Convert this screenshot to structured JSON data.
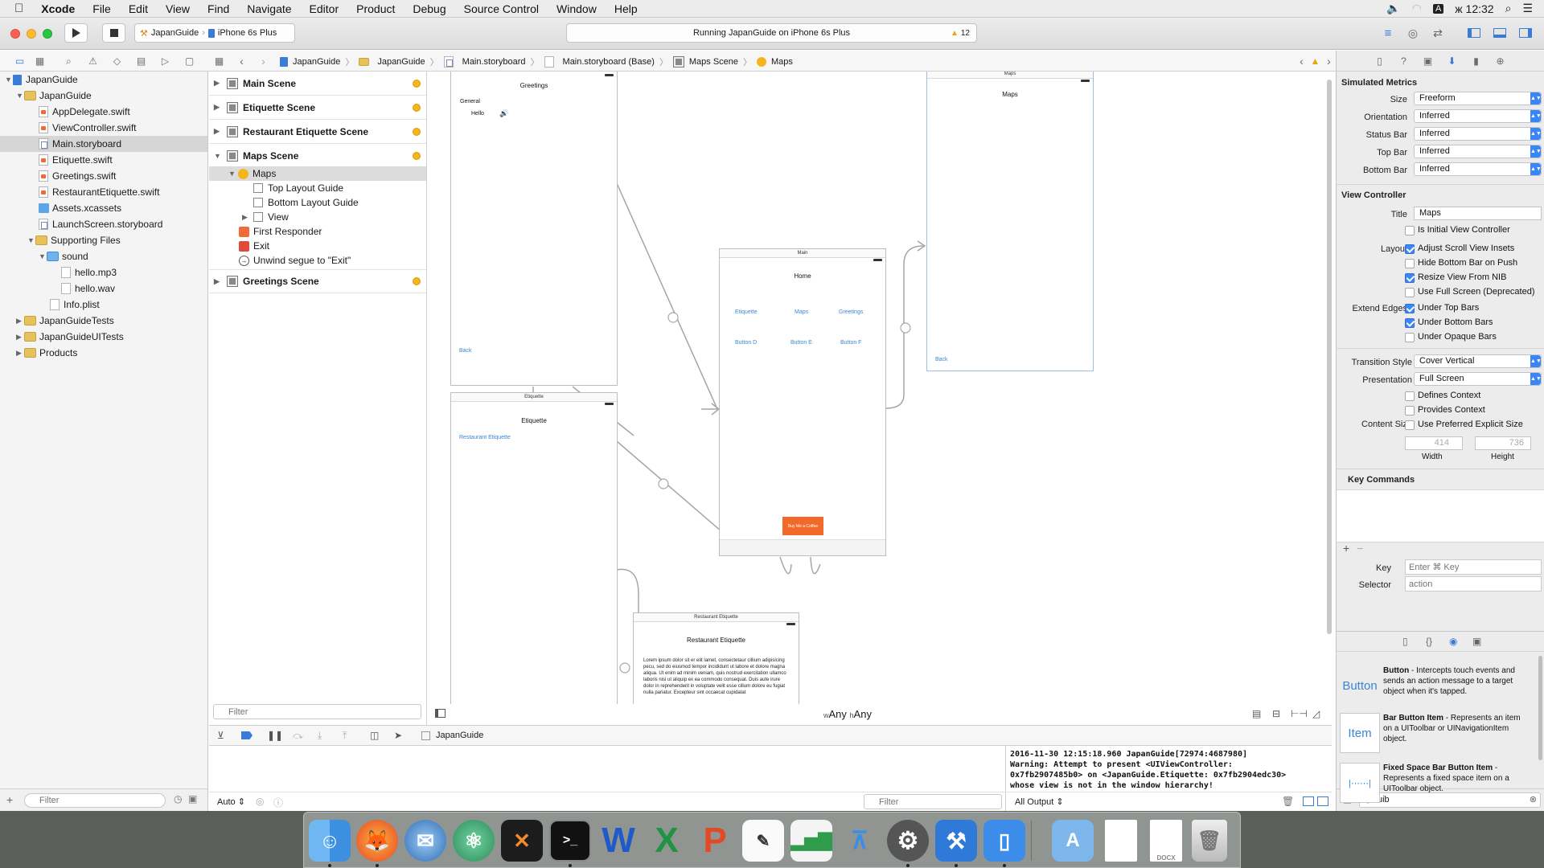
{
  "menubar": {
    "items": [
      "Xcode",
      "File",
      "Edit",
      "View",
      "Find",
      "Navigate",
      "Editor",
      "Product",
      "Debug",
      "Source Control",
      "Window",
      "Help"
    ],
    "input_source": "A",
    "clock": "ж 12:32"
  },
  "toolbar": {
    "scheme": "JapanGuide",
    "device": "iPhone 6s Plus",
    "status": "Running JapanGuide on iPhone 6s Plus",
    "warning_count": "12"
  },
  "jumpbar": {
    "crumbs": [
      "JapanGuide",
      "JapanGuide",
      "Main.storyboard",
      "Main.storyboard (Base)",
      "Maps Scene",
      "Maps"
    ]
  },
  "navigator": {
    "items": [
      {
        "label": "JapanGuide",
        "type": "project"
      },
      {
        "label": "JapanGuide",
        "type": "folder"
      },
      {
        "label": "AppDelegate.swift",
        "type": "swift"
      },
      {
        "label": "ViewController.swift",
        "type": "swift"
      },
      {
        "label": "Main.storyboard",
        "type": "storyboard"
      },
      {
        "label": "Etiquette.swift",
        "type": "swift"
      },
      {
        "label": "Greetings.swift",
        "type": "swift"
      },
      {
        "label": "RestaurantEtiquette.swift",
        "type": "swift"
      },
      {
        "label": "Assets.xcassets",
        "type": "assets"
      },
      {
        "label": "LaunchScreen.storyboard",
        "type": "storyboard"
      },
      {
        "label": "Supporting Files",
        "type": "folder"
      },
      {
        "label": "sound",
        "type": "folder-blue"
      },
      {
        "label": "hello.mp3",
        "type": "file"
      },
      {
        "label": "hello.wav",
        "type": "file"
      },
      {
        "label": "Info.plist",
        "type": "file"
      },
      {
        "label": "JapanGuideTests",
        "type": "folder"
      },
      {
        "label": "JapanGuideUITests",
        "type": "folder"
      },
      {
        "label": "Products",
        "type": "folder"
      }
    ],
    "filter_placeholder": "Filter"
  },
  "outline": {
    "scenes": [
      "Main Scene",
      "Etiquette Scene",
      "Restaurant Etiquette Scene",
      "Maps Scene",
      "Greetings Scene"
    ],
    "maps_children": [
      "Maps",
      "Top Layout Guide",
      "Bottom Layout Guide",
      "View",
      "First Responder",
      "Exit",
      "Unwind segue to \"Exit\""
    ],
    "filter_placeholder": "Filter"
  },
  "canvas": {
    "greetings": {
      "title": "Greetings",
      "label": "General",
      "hello": "Hello",
      "back": "Back"
    },
    "etiquette": {
      "header": "Etiquette",
      "title": "Etiquette",
      "link": "Restaurant Etiquette"
    },
    "main": {
      "header": "Main",
      "title": "Home",
      "row1": [
        "Etiquette",
        "Maps",
        "Greetings"
      ],
      "row2": [
        "Button D",
        "Button E",
        "Button F"
      ],
      "coffee": "Buy Me a Coffee"
    },
    "maps": {
      "header": "Maps",
      "title": "Maps",
      "back": "Back"
    },
    "restaurant": {
      "header": "Restaurant Etiquette",
      "title": "Restaurant Etiquette",
      "body": "Lorem ipsum dolor sit er elit lamet, consectetaur cillium adipisicing pecu, sed do eiusmod tempor incididunt ut labore et dolore magna aliqua. Ut enim ad minim veniam, quis nostrud exercitation ullamco laboris nisi ut aliquip ex ea commodo consequat. Duis aute irure dolor in reprehenderit in voluptate velit esse cillum dolore eu fugiat nulla pariatur. Excepteur sint occaecat cupidatat"
    },
    "size_class_w": "w",
    "size_class_w_val": "Any",
    "size_class_h": "h",
    "size_class_h_val": "Any"
  },
  "inspector": {
    "simulated_metrics": "Simulated Metrics",
    "size_label": "Size",
    "size_value": "Freeform",
    "orientation_label": "Orientation",
    "orientation_value": "Inferred",
    "statusbar_label": "Status Bar",
    "statusbar_value": "Inferred",
    "topbar_label": "Top Bar",
    "topbar_value": "Inferred",
    "bottombar_label": "Bottom Bar",
    "bottombar_value": "Inferred",
    "view_controller": "View Controller",
    "title_label": "Title",
    "title_value": "Maps",
    "is_initial": "Is Initial View Controller",
    "layout_label": "Layout",
    "layout_options": [
      {
        "label": "Adjust Scroll View Insets",
        "checked": true
      },
      {
        "label": "Hide Bottom Bar on Push",
        "checked": false
      },
      {
        "label": "Resize View From NIB",
        "checked": true
      },
      {
        "label": "Use Full Screen (Deprecated)",
        "checked": false
      }
    ],
    "extend_label": "Extend Edges",
    "extend_options": [
      {
        "label": "Under Top Bars",
        "checked": true
      },
      {
        "label": "Under Bottom Bars",
        "checked": true
      },
      {
        "label": "Under Opaque Bars",
        "checked": false
      }
    ],
    "transition_label": "Transition Style",
    "transition_value": "Cover Vertical",
    "presentation_label": "Presentation",
    "presentation_value": "Full Screen",
    "defines_context": "Defines Context",
    "provides_context": "Provides Context",
    "content_size_label": "Content Size",
    "use_preferred": "Use Preferred Explicit Size",
    "width_value": "414",
    "height_value": "736",
    "width_label": "Width",
    "height_label": "Height",
    "key_commands": "Key Commands",
    "key_label": "Key",
    "key_placeholder": "Enter ⌘ Key",
    "selector_label": "Selector",
    "selector_placeholder": "action"
  },
  "library": {
    "items": [
      {
        "icon": "Button",
        "name": "Button",
        "desc": " - Intercepts touch events and sends an action message to a target object when it's tapped."
      },
      {
        "icon": "Item",
        "name": "Bar Button Item",
        "desc": " - Represents an item on a UIToolbar or UINavigationItem object."
      },
      {
        "icon": "",
        "name": "Fixed Space Bar Button Item",
        "desc": " - Represents a fixed space item on a UIToolbar object."
      }
    ],
    "search_value": "uib"
  },
  "debug": {
    "target": "JapanGuide",
    "auto": "Auto",
    "filter_placeholder": "Filter",
    "output_select": "All Output",
    "console_text": "2016-11-30 12:15:18.960 JapanGuide[72974:4687980]\nWarning: Attempt to present <UIViewController:\n0x7fb2907485b0> on <JapanGuide.Etiquette: 0x7fb2904edc30>\nwhose view is not in the window hierarchy!"
  },
  "dock": {
    "apps": [
      "finder",
      "firefox",
      "thunderbird",
      "atom",
      "x11",
      "terminal",
      "word",
      "excel",
      "powerpoint",
      "textedit",
      "numbers",
      "keynote",
      "system-preferences",
      "xcode",
      "simulator",
      "applications",
      "document",
      "docx",
      "trash"
    ]
  },
  "colors": {
    "accent": "#3b87f5",
    "warning": "#f5b51f",
    "coffee": "#f26a2a"
  }
}
